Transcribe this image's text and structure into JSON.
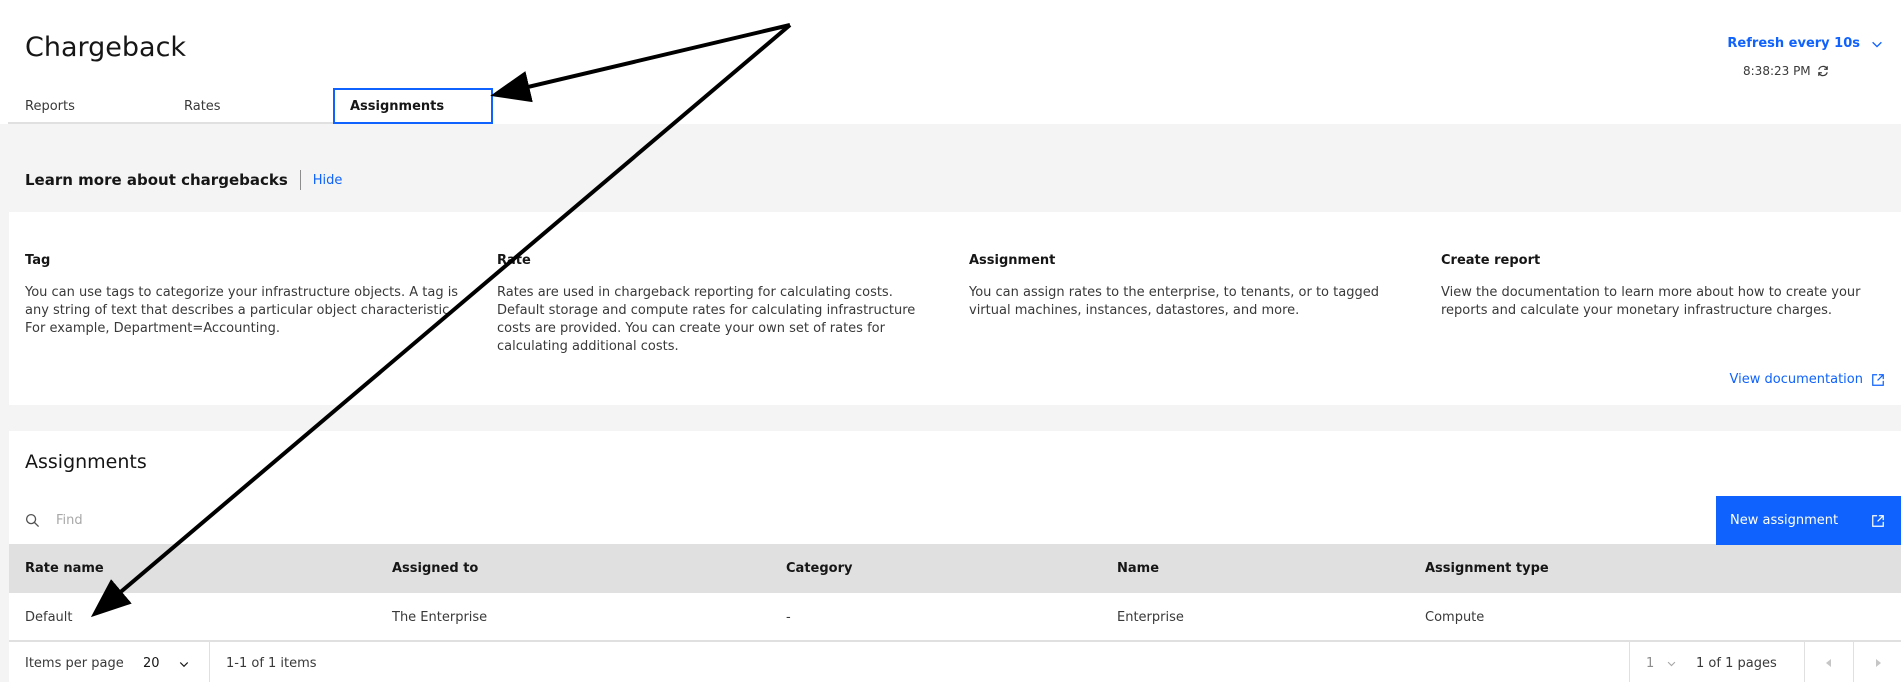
{
  "header": {
    "title": "Chargeback",
    "tabs": [
      {
        "label": "Reports"
      },
      {
        "label": "Rates"
      },
      {
        "label": "Assignments"
      }
    ],
    "refresh_label": "Refresh every 10s",
    "time": "8:38:23 PM"
  },
  "learn": {
    "title": "Learn more about chargebacks",
    "hide_label": "Hide"
  },
  "info": [
    {
      "title": "Tag",
      "text": "You can use tags to categorize your infrastructure objects. A tag is any string of text that describes a particular object characteristic. For example, Department=Accounting."
    },
    {
      "title": "Rate",
      "text": "Rates are used in chargeback reporting for calculating costs. Default storage and compute rates for calculating infrastructure costs are provided. You can create your own set of rates for calculating additional costs."
    },
    {
      "title": "Assignment",
      "text": "You can assign rates to the enterprise, to tenants, or to tagged virtual machines, instances, datastores, and more."
    },
    {
      "title": "Create report",
      "text": "View the documentation to learn more about how to create your reports and calculate your monetary infrastructure charges."
    }
  ],
  "view_doc_label": "View documentation",
  "assignments": {
    "title": "Assignments",
    "search_placeholder": "Find",
    "new_button_label": "New assignment",
    "columns": [
      "Rate name",
      "Assigned to",
      "Category",
      "Name",
      "Assignment type"
    ],
    "rows": [
      [
        "Default",
        "The Enterprise",
        "-",
        "Enterprise",
        "Compute"
      ]
    ]
  },
  "pagination": {
    "items_per_page_label": "Items per page",
    "items_per_page": "20",
    "range_text": "1-1 of 1 items",
    "page": "1",
    "pages_text": "1 of 1 pages"
  },
  "colors": {
    "accent": "#0f62fe",
    "background": "#f4f4f4",
    "table_header": "#e0e0e0",
    "annotation_arrow": "#000000"
  }
}
